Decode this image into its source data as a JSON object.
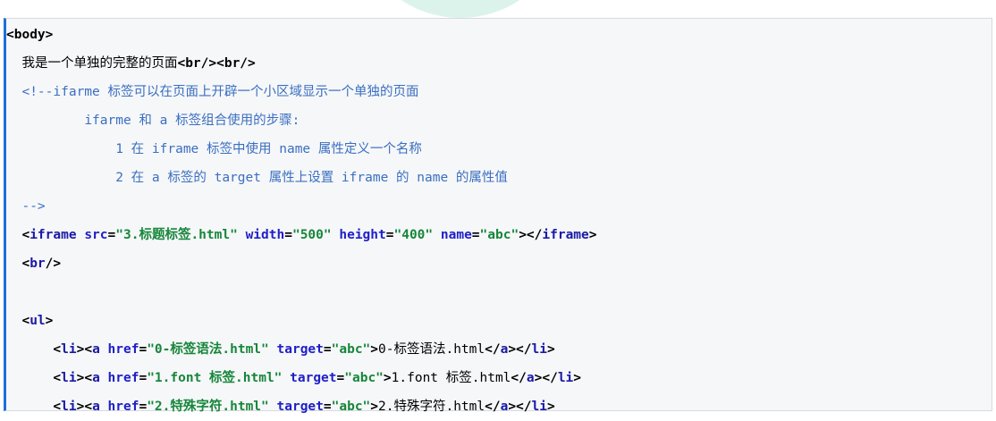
{
  "code_lines": [
    {
      "indent": 0,
      "segments": [
        {
          "t": "tag",
          "v": "<body>"
        }
      ]
    },
    {
      "indent": 2,
      "segments": [
        {
          "t": "txt",
          "v": "我是一个单独的完整的页面"
        },
        {
          "t": "tag",
          "v": "<br/><br/>"
        }
      ]
    },
    {
      "indent": 2,
      "segments": [
        {
          "t": "cmt",
          "v": "<!--ifarme 标签可以在页面上开辟一个小区域显示一个单独的页面"
        }
      ]
    },
    {
      "indent": 10,
      "segments": [
        {
          "t": "cmt",
          "v": "ifarme 和 a 标签组合使用的步骤:"
        }
      ]
    },
    {
      "indent": 14,
      "segments": [
        {
          "t": "cmt",
          "v": "1 在 iframe 标签中使用 name 属性定义一个名称"
        }
      ]
    },
    {
      "indent": 14,
      "segments": [
        {
          "t": "cmt",
          "v": "2 在 a 标签的 target 属性上设置 iframe 的 name 的属性值"
        }
      ]
    },
    {
      "indent": 2,
      "segments": [
        {
          "t": "cmt",
          "v": "-->"
        }
      ]
    },
    {
      "indent": 2,
      "segments": [
        {
          "t": "tag",
          "v": "<"
        },
        {
          "t": "tagname",
          "v": "iframe"
        },
        {
          "t": "txt",
          "v": " "
        },
        {
          "t": "attr",
          "v": "src"
        },
        {
          "t": "tag",
          "v": "="
        },
        {
          "t": "val",
          "v": "\"3.标题标签.html\""
        },
        {
          "t": "txt",
          "v": " "
        },
        {
          "t": "attr",
          "v": "width"
        },
        {
          "t": "tag",
          "v": "="
        },
        {
          "t": "val",
          "v": "\"500\""
        },
        {
          "t": "txt",
          "v": " "
        },
        {
          "t": "attr",
          "v": "height"
        },
        {
          "t": "tag",
          "v": "="
        },
        {
          "t": "val",
          "v": "\"400\""
        },
        {
          "t": "txt",
          "v": " "
        },
        {
          "t": "attr",
          "v": "name"
        },
        {
          "t": "tag",
          "v": "="
        },
        {
          "t": "val",
          "v": "\"abc\""
        },
        {
          "t": "tag",
          "v": "></"
        },
        {
          "t": "tagname",
          "v": "iframe"
        },
        {
          "t": "tag",
          "v": ">"
        }
      ]
    },
    {
      "indent": 2,
      "segments": [
        {
          "t": "tag",
          "v": "<"
        },
        {
          "t": "tagname",
          "v": "br"
        },
        {
          "t": "tag",
          "v": "/>"
        }
      ]
    },
    {
      "indent": 0,
      "segments": []
    },
    {
      "indent": 2,
      "segments": [
        {
          "t": "tag",
          "v": "<"
        },
        {
          "t": "tagname",
          "v": "ul"
        },
        {
          "t": "tag",
          "v": ">"
        }
      ]
    },
    {
      "indent": 6,
      "segments": [
        {
          "t": "tag",
          "v": "<"
        },
        {
          "t": "tagname",
          "v": "li"
        },
        {
          "t": "tag",
          "v": "><"
        },
        {
          "t": "tagname",
          "v": "a"
        },
        {
          "t": "txt",
          "v": " "
        },
        {
          "t": "attr",
          "v": "href"
        },
        {
          "t": "tag",
          "v": "="
        },
        {
          "t": "val",
          "v": "\"0-标签语法.html\""
        },
        {
          "t": "txt",
          "v": " "
        },
        {
          "t": "attr",
          "v": "target"
        },
        {
          "t": "tag",
          "v": "="
        },
        {
          "t": "val",
          "v": "\"abc\""
        },
        {
          "t": "tag",
          "v": ">"
        },
        {
          "t": "txt",
          "v": "0-标签语法.html"
        },
        {
          "t": "tag",
          "v": "</"
        },
        {
          "t": "tagname",
          "v": "a"
        },
        {
          "t": "tag",
          "v": "></"
        },
        {
          "t": "tagname",
          "v": "li"
        },
        {
          "t": "tag",
          "v": ">"
        }
      ]
    },
    {
      "indent": 6,
      "segments": [
        {
          "t": "tag",
          "v": "<"
        },
        {
          "t": "tagname",
          "v": "li"
        },
        {
          "t": "tag",
          "v": "><"
        },
        {
          "t": "tagname",
          "v": "a"
        },
        {
          "t": "txt",
          "v": " "
        },
        {
          "t": "attr",
          "v": "href"
        },
        {
          "t": "tag",
          "v": "="
        },
        {
          "t": "val",
          "v": "\"1.font 标签.html\""
        },
        {
          "t": "txt",
          "v": " "
        },
        {
          "t": "attr",
          "v": "target"
        },
        {
          "t": "tag",
          "v": "="
        },
        {
          "t": "val",
          "v": "\"abc\""
        },
        {
          "t": "tag",
          "v": ">"
        },
        {
          "t": "txt",
          "v": "1.font 标签.html"
        },
        {
          "t": "tag",
          "v": "</"
        },
        {
          "t": "tagname",
          "v": "a"
        },
        {
          "t": "tag",
          "v": "></"
        },
        {
          "t": "tagname",
          "v": "li"
        },
        {
          "t": "tag",
          "v": ">"
        }
      ]
    },
    {
      "indent": 6,
      "segments": [
        {
          "t": "tag",
          "v": "<"
        },
        {
          "t": "tagname",
          "v": "li"
        },
        {
          "t": "tag",
          "v": "><"
        },
        {
          "t": "tagname",
          "v": "a"
        },
        {
          "t": "txt",
          "v": " "
        },
        {
          "t": "attr",
          "v": "href"
        },
        {
          "t": "tag",
          "v": "="
        },
        {
          "t": "val",
          "v": "\"2.特殊字符.html\""
        },
        {
          "t": "txt",
          "v": " "
        },
        {
          "t": "attr",
          "v": "target"
        },
        {
          "t": "tag",
          "v": "="
        },
        {
          "t": "val",
          "v": "\"abc\""
        },
        {
          "t": "tag",
          "v": ">"
        },
        {
          "t": "txt",
          "v": "2.特殊字符.html"
        },
        {
          "t": "tag",
          "v": "</"
        },
        {
          "t": "tagname",
          "v": "a"
        },
        {
          "t": "tag",
          "v": "></"
        },
        {
          "t": "tagname",
          "v": "li"
        },
        {
          "t": "tag",
          "v": ">"
        }
      ]
    }
  ]
}
